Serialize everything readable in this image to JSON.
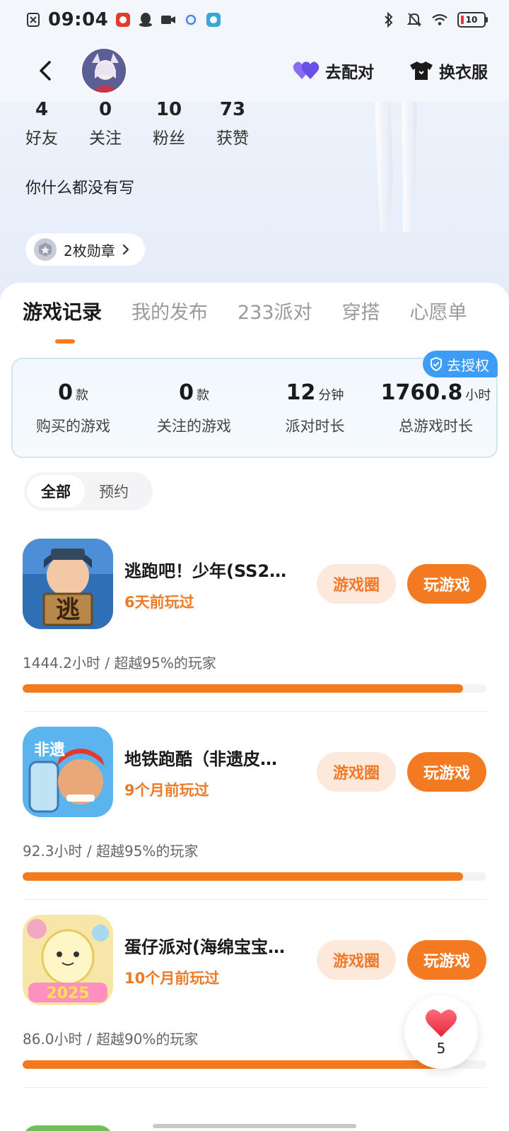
{
  "status_bar": {
    "time": "09:04",
    "battery_level": "10"
  },
  "nav": {
    "match_label": "去配对",
    "outfit_label": "换衣服"
  },
  "profile": {
    "stats": [
      {
        "value": "4",
        "label": "好友"
      },
      {
        "value": "0",
        "label": "关注"
      },
      {
        "value": "10",
        "label": "粉丝"
      },
      {
        "value": "73",
        "label": "获赞"
      }
    ],
    "bio": "你什么都没有写",
    "medals_label": "2枚勋章"
  },
  "tabs": [
    {
      "label": "游戏记录",
      "active": true
    },
    {
      "label": "我的发布",
      "active": false
    },
    {
      "label": "233派对",
      "active": false
    },
    {
      "label": "穿搭",
      "active": false
    },
    {
      "label": "心愿单",
      "active": false
    }
  ],
  "summary": {
    "auth_label": "去授权",
    "items": [
      {
        "value": "0",
        "unit": "款",
        "label": "购买的游戏"
      },
      {
        "value": "0",
        "unit": "款",
        "label": "关注的游戏"
      },
      {
        "value": "12",
        "unit": "分钟",
        "label": "派对时长"
      },
      {
        "value": "1760.8",
        "unit": "小时",
        "label": "总游戏时长"
      }
    ]
  },
  "filters": [
    {
      "label": "全部",
      "active": true
    },
    {
      "label": "预约",
      "active": false
    }
  ],
  "games": [
    {
      "title": "逃跑吧！少年(SS2…",
      "last_played": "6天前玩过",
      "circle_label": "游戏圈",
      "play_label": "玩游戏",
      "stat": "1444.2小时 / 超越95%的玩家",
      "progress": 0.95
    },
    {
      "title": "地铁跑酷（非遗皮…",
      "last_played": "9个月前玩过",
      "circle_label": "游戏圈",
      "play_label": "玩游戏",
      "stat": "92.3小时 / 超越95%的玩家",
      "progress": 0.95
    },
    {
      "title": "蛋仔派对(海绵宝宝…",
      "last_played": "10个月前玩过",
      "circle_label": "游戏圈",
      "play_label": "玩游戏",
      "stat": "86.0小时 / 超越90%的玩家",
      "progress": 0.9
    }
  ],
  "like_fab": {
    "count": "5"
  },
  "colors": {
    "accent": "#f47a22",
    "accent_light": "#fde8dc",
    "auth_blue": "#3d9cf5",
    "match_purple": "#7b5cf0"
  }
}
